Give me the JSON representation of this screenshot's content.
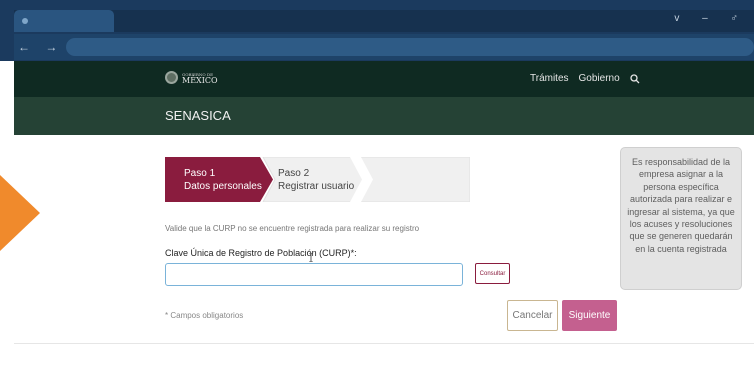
{
  "window": {
    "controls": "v  –  ♂"
  },
  "nav": {
    "buttons": "←  →  C"
  },
  "gov_header": {
    "logo_small": "GOBIERNO DE",
    "logo_text": "MÉXICO",
    "links": [
      "Trámites",
      "Gobierno"
    ],
    "search_icon": "search-icon"
  },
  "agency": {
    "name": "SENASICA"
  },
  "stepper": {
    "steps": [
      {
        "number": "Paso 1",
        "title": "Datos personales",
        "state": "active"
      },
      {
        "number": "Paso 2",
        "title": "Registrar usuario",
        "state": "pending"
      }
    ]
  },
  "form": {
    "help_text": "Valide que la CURP no se encuentre registrada para realizar su registro",
    "curp_label": "Clave Única de Registro de Población (CURP)*:",
    "curp_value": "",
    "consult_label": "Consultar",
    "required_note": "* Campos obligatorios",
    "cancel_label": "Cancelar",
    "next_label": "Siguiente"
  },
  "info": {
    "text": "Es responsabilidad de la empresa asignar a la persona específica autorizada para realizar e ingresar al sistema, ya que los acuses y resoluciones que se generen quedarán en la cuenta registrada"
  },
  "colors": {
    "accent": "#8a1c3e",
    "next_button": "#c4608f",
    "gov_header": "#0f2a22",
    "agency_band": "#254235",
    "browser": "#1b3a5e",
    "arrow": "#f08a2c"
  }
}
